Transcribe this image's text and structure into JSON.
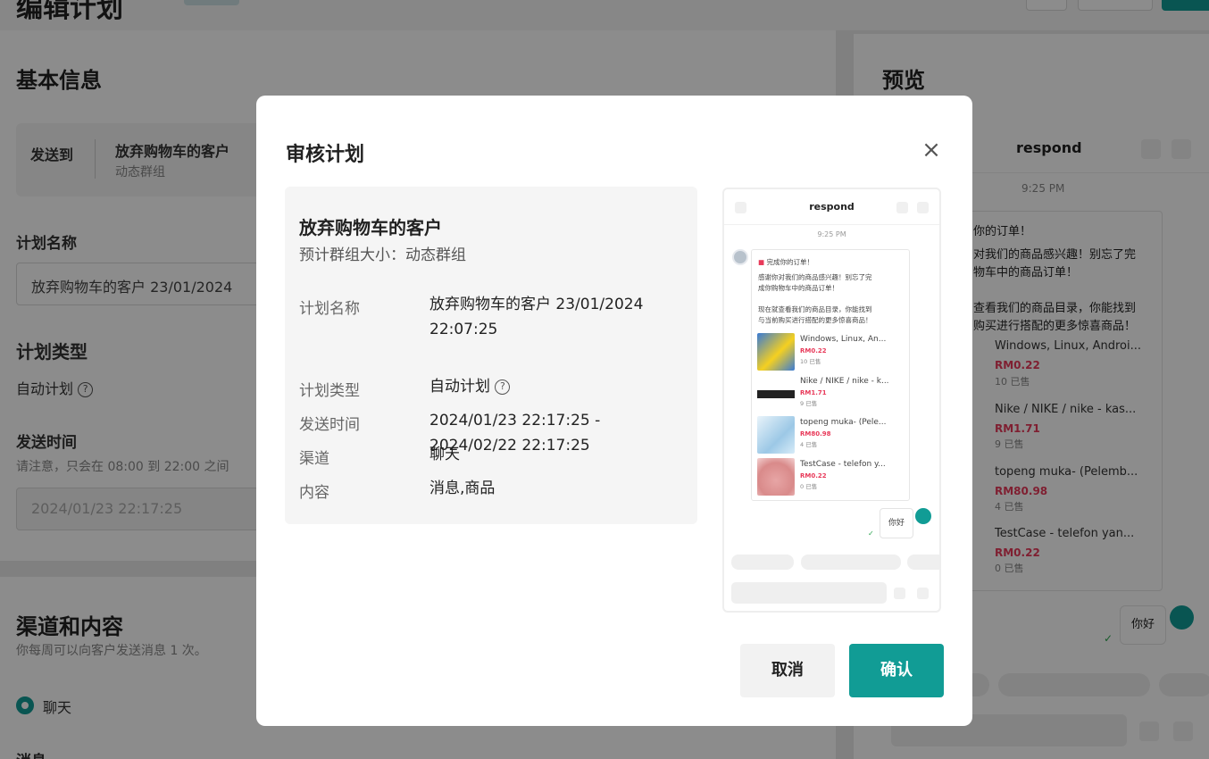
{
  "page": {
    "title": "编辑计划"
  },
  "basic_info": {
    "heading": "基本信息",
    "send_to_label": "发送到",
    "group_name": "放弃购物车的客户",
    "group_type": "动态群组",
    "plan_name_label": "计划名称",
    "plan_name_value": "放弃购物车的客户 23/01/2024",
    "plan_type_label": "计划类型",
    "plan_type_value": "自动计划",
    "send_time_label": "发送时间",
    "send_time_hint": "请注意，只会在 08:00 到 22:00 之间",
    "send_time_value": "2024/01/23 22:17:25"
  },
  "channel_content": {
    "heading": "渠道和内容",
    "hint": "你每周可以向客户发送消息 1 次。",
    "channel_option": "聊天",
    "message_label": "消息"
  },
  "preview_panel": {
    "heading": "预览",
    "chat_title": "respond",
    "time": "9:25 PM",
    "msg_title": "你的订单！",
    "msg_line1": "对我们的商品感兴趣！别忘了完",
    "msg_line2": "物车中的商品订单！",
    "msg_line3": "查看我们的商品目录，你能找到",
    "msg_line4": "购买进行搭配的更多惊喜商品！",
    "products": [
      {
        "name": "Windows, Linux, Androi...",
        "price": "RM0.22",
        "sold": "10 已售"
      },
      {
        "name": "Nike / NIKE / nike - kas...",
        "price": "RM1.71",
        "sold": "9 已售"
      },
      {
        "name": "topeng muka- (Pelemb...",
        "price": "RM80.98",
        "sold": "4 已售"
      },
      {
        "name": "TestCase - telefon yan...",
        "price": "RM0.22",
        "sold": "0 已售"
      }
    ],
    "reply": "你好"
  },
  "modal": {
    "title": "审核计划",
    "close_icon": "close-icon",
    "group_name": "放弃购物车的客户",
    "group_size": "预计群组大小：动态群组",
    "rows": [
      {
        "key": "计划名称",
        "value": "放弃购物车的客户 23/01/2024 22:07:25"
      },
      {
        "key": "计划类型",
        "value": "自动计划"
      },
      {
        "key": "发送时间",
        "value": "2024/01/23 22:17:25 - 2024/02/22 22:17:25"
      },
      {
        "key": "渠道",
        "value": "聊天"
      },
      {
        "key": "内容",
        "value": "消息,商品"
      }
    ],
    "cancel_label": "取消",
    "confirm_label": "确认",
    "accent_color": "#119c95"
  },
  "modal_preview": {
    "chat_title": "respond",
    "time": "9:25 PM",
    "msg_title": "完成你的订单！",
    "msg_line1": "感谢你对我们的商品感兴趣！别忘了完",
    "msg_line2": "成你购物车中的商品订单！",
    "msg_line3": "现在就查看我们的商品目录，你能找到",
    "msg_line4": "与当前购买进行搭配的更多惊喜商品！",
    "products": [
      {
        "name": "Windows, Linux, An...",
        "price": "RM0.22",
        "sold": "10 已售"
      },
      {
        "name": "Nike / NIKE / nike - k...",
        "price": "RM1.71",
        "sold": "9 已售"
      },
      {
        "name": "topeng muka- (Pele...",
        "price": "RM80.98",
        "sold": "4 已售"
      },
      {
        "name": "TestCase - telefon y...",
        "price": "RM0.22",
        "sold": "0 已售"
      }
    ],
    "reply": "你好"
  }
}
